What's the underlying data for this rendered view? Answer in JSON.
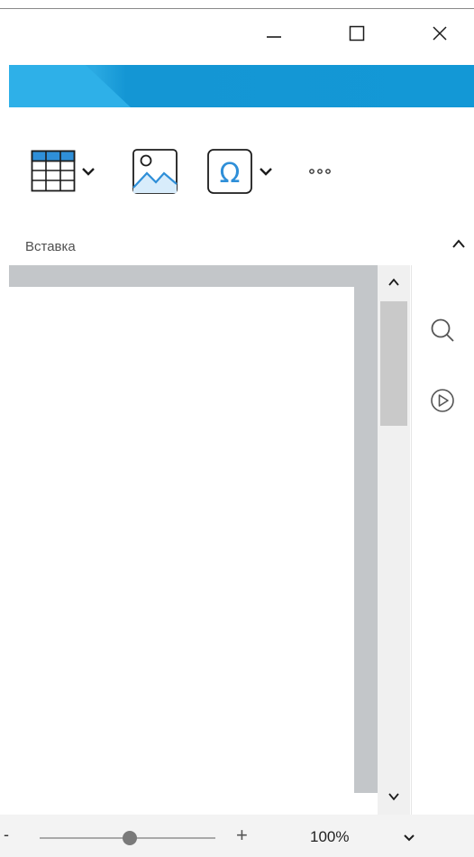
{
  "window": {
    "buttons": [
      "minimize-icon",
      "maximize-icon",
      "close-icon"
    ]
  },
  "ribbon": {
    "tools": [
      {
        "name": "table-icon",
        "has_dropdown": true
      },
      {
        "name": "image-icon",
        "has_dropdown": false
      },
      {
        "name": "symbol-omega-icon",
        "has_dropdown": true
      },
      {
        "name": "more-icon",
        "has_dropdown": false
      }
    ],
    "group_label": "Вставка",
    "accent": "#1398d6",
    "icon_blue": "#2f8fd8"
  },
  "right_panel": {
    "icons": [
      "search-icon",
      "play-circle-icon"
    ]
  },
  "status_bar": {
    "zoom_minus": "-",
    "zoom_plus": "+",
    "zoom_level": "100%",
    "zoom_slider_fraction": 0.5
  }
}
